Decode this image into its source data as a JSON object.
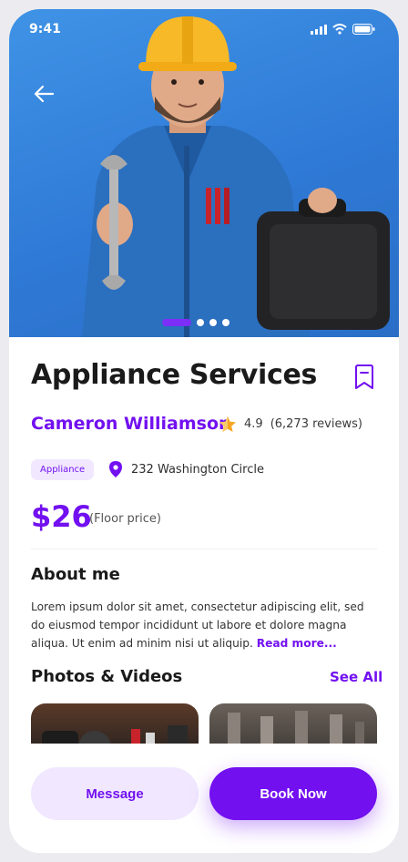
{
  "status_bar": {
    "time": "9:41"
  },
  "hero": {
    "image_subject": "worker in blue coveralls and yellow hard hat holding a wrench and a tool case",
    "slide_count": 5,
    "active_slide": 0
  },
  "service": {
    "title": "Appliance Services",
    "provider_name": "Cameron Williamson",
    "rating": "4.9",
    "reviews": "(6,273 reviews)",
    "category_badge": "Appliance",
    "location": "232 Washington Circle",
    "price": "$26",
    "price_note": "(Floor price)"
  },
  "about": {
    "title": "About me",
    "body": "Lorem ipsum dolor sit amet, consectetur adipiscing elit, sed do eiusmod tempor incididunt ut labore et dolore magna aliqua. Ut enim ad minim nisi ut aliquip.",
    "read_more": "Read more..."
  },
  "photos": {
    "title": "Photos & Videos",
    "see_all": "See All"
  },
  "actions": {
    "message_label": "Message",
    "book_label": "Book Now"
  },
  "colors": {
    "accent": "#7210F0",
    "accent_soft": "#F1E8FF",
    "star": "#F6A623",
    "hero_bg": "#3A8AE0"
  }
}
